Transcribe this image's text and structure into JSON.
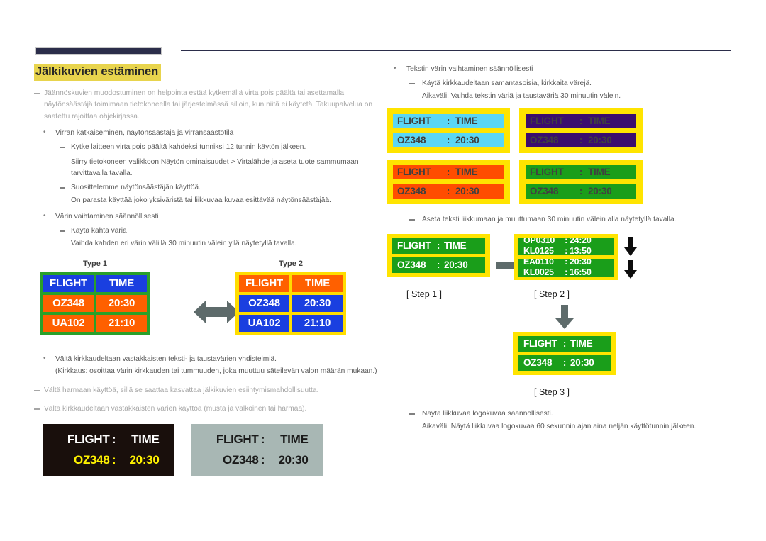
{
  "page": {
    "title": "Jälkikuvien estäminen"
  },
  "left": {
    "intro": "Jäännöskuvien muodostuminen on helpointa estää kytkemällä virta pois päältä tai asettamalla näytönsäästäjä toimimaan tietokoneella tai järjestelmässä silloin, kun niitä ei käytetä. Takuupalvelua on saatettu rajoittaa ohjekirjassa.",
    "bullet1": "Virran katkaiseminen, näytönsäästäjä ja virransäästötila",
    "b1_sub1": "Kytke laitteen virta pois päältä kahdeksi tunniksi 12 tunnin käytön jälkeen.",
    "b1_sub2": "Siirry tietokoneen valikkoon Näytön ominaisuudet > Virtalähde ja aseta tuote sammumaan tarvittavalla tavalla.",
    "b1_sub3": "Suosittelemme näytönsäästäjän käyttöä.",
    "b1_sub3_note": "On parasta käyttää joko yksiväristä tai liikkuvaa kuvaa esittävää näytönsäästäjää.",
    "bullet2": "Värin vaihtaminen säännöllisesti",
    "b2_sub1": "Käytä kahta väriä",
    "b2_sub1_note": "Vaihda kahden eri värin välillä 30 minuutin välein yllä näytetyllä tavalla.",
    "bullet3": "Vältä kirkkaudeltaan vastakkaisten teksti- ja taustavärien yhdistelmiä.",
    "bullet3_note": "(Kirkkaus: osoittaa värin kirkkauden tai tummuuden, joka muuttuu säteilevän valon määrän mukaan.)",
    "dash2": "Vältä harmaan käyttöä, sillä se saattaa kasvattaa jälkikuvien esiintymismahdollisuutta.",
    "dash3": "Vältä kirkkaudeltaan vastakkaisten värien käyttöä (musta ja valkoinen tai harmaa)."
  },
  "type_boards": [
    {
      "label": "Type 1",
      "frame_color": "#2aa02a",
      "header": {
        "flight": "FLIGHT",
        "time": "TIME",
        "cell_color": "#1a3fe0"
      },
      "rows": [
        {
          "flight": "OZ348",
          "time": "20:30",
          "cell_color": "#ff6000"
        },
        {
          "flight": "UA102",
          "time": "21:10",
          "cell_color": "#ff6000"
        }
      ]
    },
    {
      "label": "Type 2",
      "frame_color": "#ffdd00",
      "header": {
        "flight": "FLIGHT",
        "time": "TIME",
        "cell_color": "#ff6000"
      },
      "rows": [
        {
          "flight": "OZ348",
          "time": "20:30",
          "cell_color": "#1a3fe0"
        },
        {
          "flight": "UA102",
          "time": "21:10",
          "cell_color": "#1a3fe0"
        }
      ]
    }
  ],
  "simple_boards": [
    {
      "style": "black",
      "bg": "#190f0c",
      "line1": {
        "a": "FLIGHT",
        "sep": ":",
        "b": "TIME",
        "color": "#ffffff"
      },
      "line2": {
        "a": "OZ348",
        "sep": ":",
        "b": "20:30",
        "color": "#fff200"
      }
    },
    {
      "style": "gray",
      "bg": "#a8b7b4",
      "line1": {
        "a": "FLIGHT",
        "sep": ":",
        "b": "TIME",
        "color": "#1a1a1a"
      },
      "line2": {
        "a": "OZ348",
        "sep": ":",
        "b": "20:30",
        "color": "#1a1a1a"
      }
    }
  ],
  "right": {
    "bullet1": "Tekstin värin vaihtaminen säännöllisesti",
    "b1_sub1": "Käytä kirkkaudeltaan samantasoisia, kirkkaita värejä.",
    "b1_sub1_note": "Aikaväli: Vaihda tekstin väriä ja taustaväriä 30 minuutin välein.",
    "sub_move": "Aseta teksti liikkumaan ja muuttumaan 30 minuutin välein alla näytetyllä tavalla.",
    "sub_logo": "Näytä liikkuvaa logokuvaa säännöllisesti.",
    "sub_logo_note": "Aikaväli: Näytä liikkuvaa logokuvaa 60 sekunnin ajan aina neljän käyttötunnin jälkeen."
  },
  "color_boards": [
    {
      "skin": "cyan",
      "bg": "#5ad6f5",
      "text_color": "#1a35c8",
      "frame": "#ffe400",
      "line1": {
        "a": "FLIGHT",
        "sep": ":",
        "b": "TIME"
      },
      "line2": {
        "a": "OZ348",
        "sep": ":",
        "b": "20:30"
      }
    },
    {
      "skin": "purple",
      "bg": "#3b0d6e",
      "text_color": "#ffffff",
      "frame": "#ffe400",
      "line1": {
        "a": "FLIGHT",
        "sep": ":",
        "b": "TIME"
      },
      "line2": {
        "a": "OZ348",
        "sep": ":",
        "b": "20:30"
      }
    },
    {
      "skin": "orange",
      "bg": "#ff4d00",
      "text_color": "#1a1a1a",
      "frame": "#ffe400",
      "line1": {
        "a": "FLIGHT",
        "sep": ":",
        "b": "TIME"
      },
      "line2": {
        "a": "OZ348",
        "sep": ":",
        "b": "20:30"
      }
    },
    {
      "skin": "green",
      "bg": "#1a9e1a",
      "text_color": "#ffffff",
      "frame": "#ffe400",
      "line1": {
        "a": "FLIGHT",
        "sep": ":",
        "b": "TIME"
      },
      "line2": {
        "a": "OZ348",
        "sep": ":",
        "b": "20:30"
      }
    }
  ],
  "steps": {
    "step1": {
      "label": "[ Step 1 ]",
      "line1": {
        "a": "FLIGHT",
        "sep": ":",
        "b": "TIME"
      },
      "line2": {
        "a": "OZ348",
        "sep": ":",
        "b": "20:30"
      }
    },
    "step2": {
      "label": "[ Step 2 ]",
      "win1_top": {
        "a": "OP0310",
        "sep": ":",
        "b": "24:20"
      },
      "win1_bot": {
        "a": "KL0125",
        "sep": ":",
        "b": "13:50"
      },
      "win2_top": {
        "a": "EA0110",
        "sep": ":",
        "b": "20:30"
      },
      "win2_bot": {
        "a": "KL0025",
        "sep": ":",
        "b": "16:50"
      }
    },
    "step3": {
      "label": "[ Step 3 ]",
      "line1": {
        "a": "FLIGHT",
        "sep": ":",
        "b": "TIME"
      },
      "line2": {
        "a": "OZ348",
        "sep": ":",
        "b": "20:30"
      }
    }
  }
}
